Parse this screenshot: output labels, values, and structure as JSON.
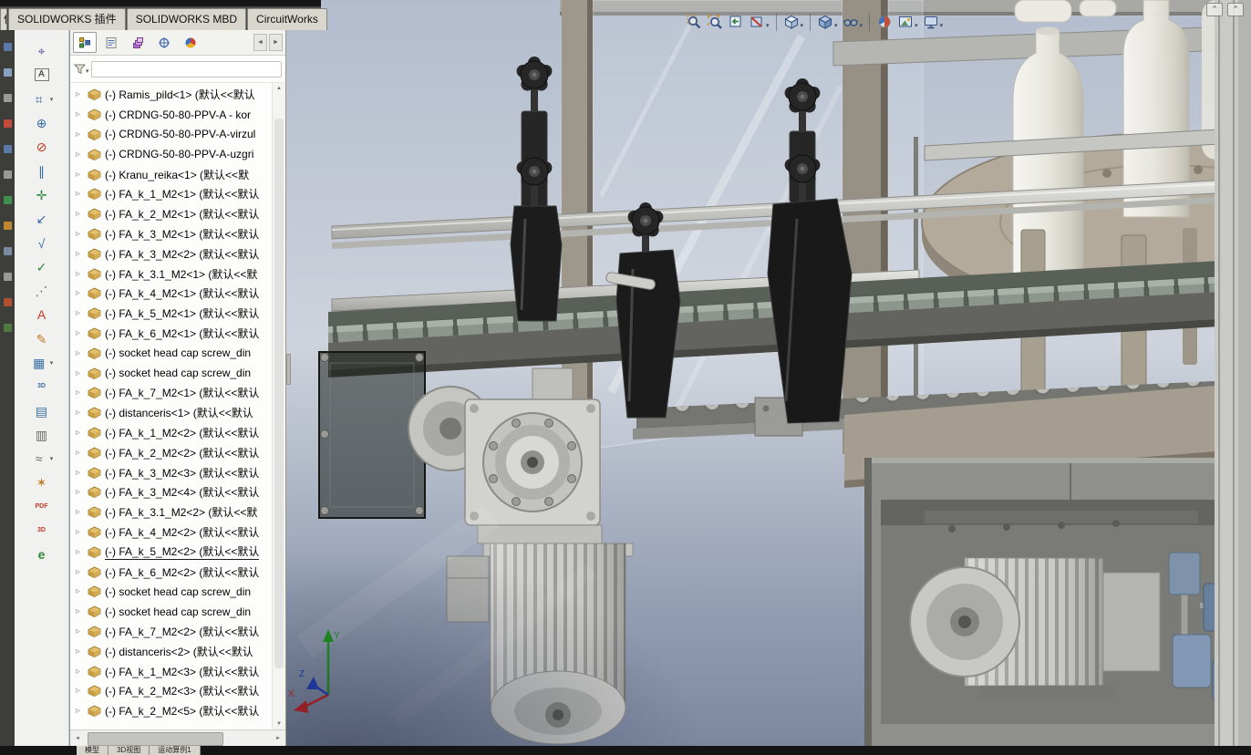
{
  "app": {
    "name": "SOLIDWORKS"
  },
  "ribbon": {
    "partial_tab": "估",
    "tabs": [
      "SOLIDWORKS 插件",
      "SOLIDWORKS MBD",
      "CircuitWorks"
    ]
  },
  "icons": {
    "caret": "▾",
    "expander": "▹",
    "scroll_up": "▲",
    "scroll_down": "▼",
    "scroll_left": "◄",
    "scroll_right": "►",
    "tab_prev": "◄",
    "tab_next": "►",
    "collapse": "^"
  },
  "left_toolbar": {
    "items": [
      {
        "name": "location-dimension-icon",
        "glyph": "⌖"
      },
      {
        "name": "note-icon",
        "glyph": "A"
      },
      {
        "name": "size-dimension-icon",
        "glyph": "⌗",
        "caret": true
      },
      {
        "name": "datum-target-icon",
        "glyph": "⊕"
      },
      {
        "name": "geometric-tolerance-icon",
        "glyph": "⊘"
      },
      {
        "name": "datum-feature-icon",
        "glyph": "∥"
      },
      {
        "name": "pattern-dimension-icon",
        "glyph": "✛"
      },
      {
        "name": "break-view-icon",
        "glyph": "↙"
      },
      {
        "name": "surface-finish-icon",
        "glyph": "√"
      },
      {
        "name": "spell-checker-icon",
        "glyph": "✓"
      },
      {
        "name": "multi-jog-leader-icon",
        "glyph": "⋰"
      },
      {
        "name": "text-annotation-icon",
        "glyph": "A"
      },
      {
        "name": "format-painter-icon",
        "glyph": "✎"
      },
      {
        "name": "general-table-icon",
        "glyph": "▦",
        "caret": true
      },
      {
        "name": "3d-drawing-view-icon",
        "glyph": "3D"
      },
      {
        "name": "view-palette-icon",
        "glyph": "▤"
      },
      {
        "name": "compare-documents-icon",
        "glyph": "▥"
      },
      {
        "name": "magnetic-line-icon",
        "glyph": "≈",
        "caret": true
      },
      {
        "name": "edit-appearance-tool-icon",
        "glyph": "✶"
      },
      {
        "name": "publish-pdf-icon",
        "glyph": "PDF"
      },
      {
        "name": "publish-3d-pdf-icon",
        "glyph": "3D"
      },
      {
        "name": "publish-edrawings-icon",
        "glyph": "e"
      }
    ]
  },
  "feature_panel": {
    "tabs": [
      "featuremanager-design-tree",
      "propertymanager",
      "configurationmanager",
      "dimxpertmanager",
      "displaymanager"
    ],
    "filter_value": "",
    "tree": [
      "(-) Ramis_pild<1> (默认<<默认",
      "(-) CRDNG-50-80-PPV-A - kor",
      "(-) CRDNG-50-80-PPV-A-virzul",
      "(-) CRDNG-50-80-PPV-A-uzgri",
      "(-) Kranu_reika<1> (默认<<默",
      "(-) FA_k_1_M2<1> (默认<<默认",
      "(-) FA_k_2_M2<1> (默认<<默认",
      "(-) FA_k_3_M2<1> (默认<<默认",
      "(-) FA_k_3_M2<2> (默认<<默认",
      "(-) FA_k_3.1_M2<1> (默认<<默",
      "(-) FA_k_4_M2<1> (默认<<默认",
      "(-) FA_k_5_M2<1> (默认<<默认",
      "(-) FA_k_6_M2<1> (默认<<默认",
      "(-) socket head cap screw_din",
      "(-) socket head cap screw_din",
      "(-) FA_k_7_M2<1> (默认<<默认",
      "(-) distanceris<1> (默认<<默认",
      "(-) FA_k_1_M2<2> (默认<<默认",
      "(-) FA_k_2_M2<2> (默认<<默认",
      "(-) FA_k_3_M2<3> (默认<<默认",
      "(-) FA_k_3_M2<4> (默认<<默认",
      "(-) FA_k_3.1_M2<2> (默认<<默",
      "(-) FA_k_4_M2<2> (默认<<默认",
      "(-) FA_k_5_M2<2> (默认<<默认",
      "(-) FA_k_6_M2<2> (默认<<默认",
      "(-) socket head cap screw_din",
      "(-) socket head cap screw_din",
      "(-) FA_k_7_M2<2> (默认<<默认",
      "(-) distanceris<2> (默认<<默认",
      "(-) FA_k_1_M2<3> (默认<<默认",
      "(-) FA_k_2_M2<3> (默认<<默认",
      "(-) FA_k_2_M2<5> (默认<<默认"
    ],
    "selected_item": "(-) FA_k_5_M2<2> (默认<<默认"
  },
  "hud": {
    "items": [
      "zoom-fit",
      "zoom-area",
      "previous-view",
      "section-view",
      "view-orientation",
      "display-style",
      "hide-show-items",
      "edit-appearance",
      "apply-scene",
      "view-settings"
    ]
  },
  "viewport": {
    "triad": {
      "x": "X",
      "y": "Y",
      "z": "Z"
    }
  },
  "status_bar": {
    "tabs": [
      "模型",
      "3D视图",
      "运动算例1"
    ]
  },
  "colors": {
    "viewport_top": "#b3bdce",
    "viewport_bottom": "#7c88a0",
    "ribbon_bg": "#4a4a46",
    "tab_face": "#d9d6ce"
  }
}
